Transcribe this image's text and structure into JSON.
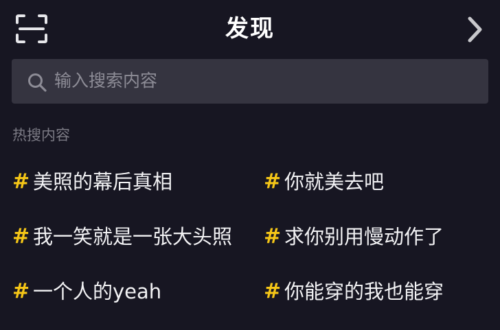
{
  "header": {
    "title": "发现",
    "scan_icon": "scan-icon",
    "next_icon": "chevron-right-icon"
  },
  "search": {
    "placeholder": "输入搜索内容",
    "icon": "search-icon"
  },
  "hot_section": {
    "label": "热搜内容",
    "marker": "#",
    "items": [
      {
        "label": "美照的幕后真相"
      },
      {
        "label": "你就美去吧"
      },
      {
        "label": "我一笑就是一张大头照"
      },
      {
        "label": "求你别用慢动作了"
      },
      {
        "label": "一个人的yeah"
      },
      {
        "label": "你能穿的我也能穿"
      }
    ]
  },
  "colors": {
    "background": "#171622",
    "search_bg": "#353440",
    "accent_hash": "#f5c617",
    "muted_text": "#7b7a84"
  }
}
